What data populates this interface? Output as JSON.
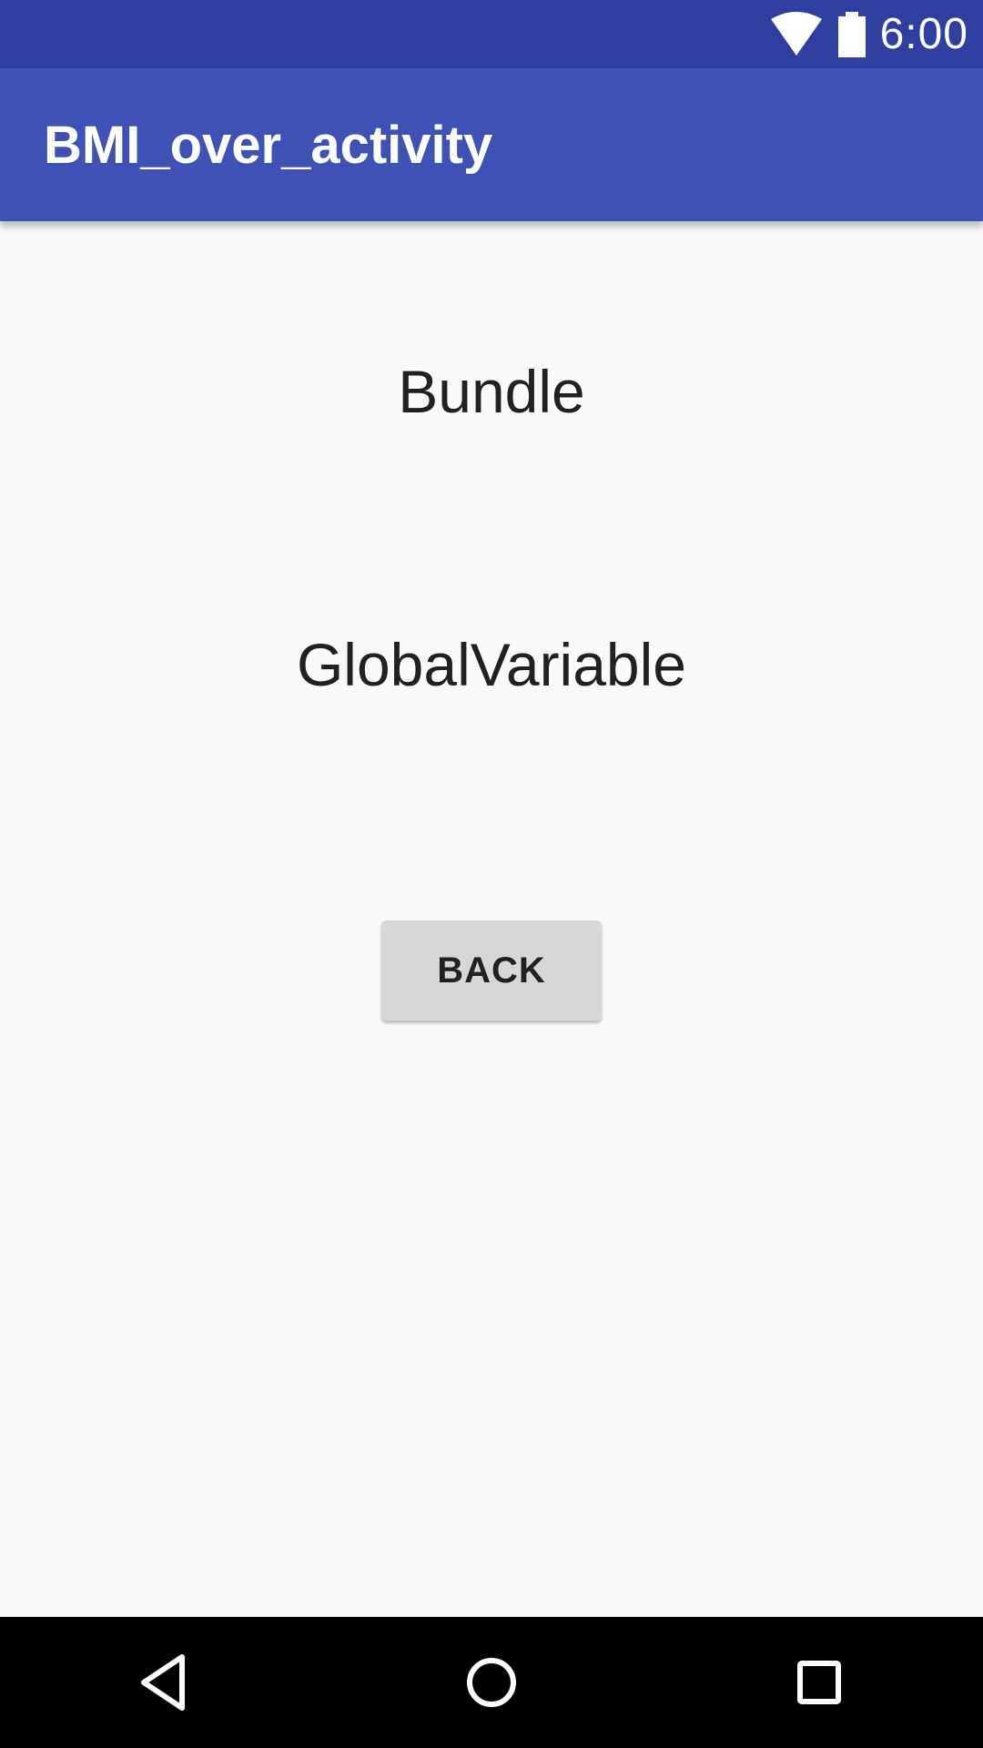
{
  "status_bar": {
    "time": "6:00",
    "icons": [
      "wifi-icon",
      "battery-icon"
    ]
  },
  "app_bar": {
    "title": "BMI_over_activity"
  },
  "content": {
    "line1": "Bundle",
    "line2": "GlobalVariable",
    "back_button_label": "BACK"
  },
  "nav_bar": {
    "icons": [
      "back-icon",
      "home-icon",
      "recents-icon"
    ]
  },
  "colors": {
    "status_bar": "#303f9f",
    "app_bar": "#3f51b5",
    "background": "#fafafa",
    "button": "#d6d7d7",
    "text": "#212121",
    "nav_bar": "#000000"
  }
}
